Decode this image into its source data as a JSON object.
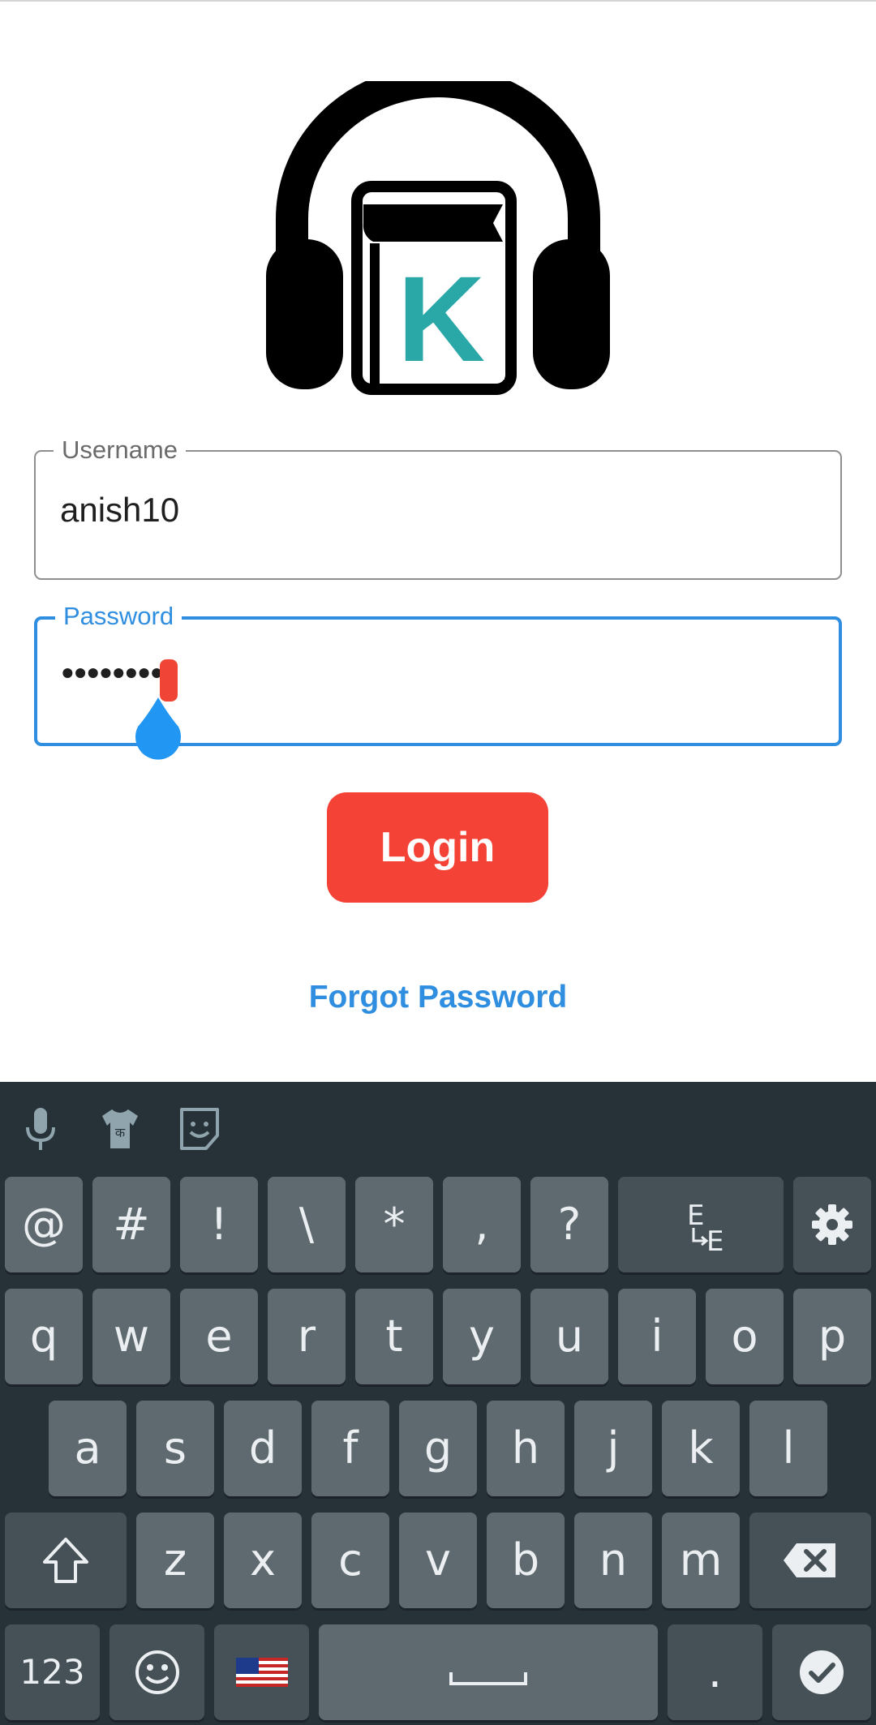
{
  "form": {
    "username_label": "Username",
    "username_value": "anish10",
    "password_label": "Password",
    "password_value": "••••••••",
    "login_label": "Login",
    "forgot_label": "Forgot Password"
  },
  "logo": {
    "letter": "K",
    "color_accent": "#2aa7a7"
  },
  "colors": {
    "primary": "#2f8ee0",
    "login": "#f44336",
    "keyboard_bg": "#263238",
    "key_bg": "#5f6a70"
  },
  "keyboard": {
    "toolbar": [
      "mic-icon",
      "shirt-icon",
      "sticker-icon"
    ],
    "row0": [
      "@",
      "#",
      "!",
      "\\",
      "*",
      ",",
      "?"
    ],
    "row1": [
      "q",
      "w",
      "e",
      "r",
      "t",
      "y",
      "u",
      "i",
      "o",
      "p"
    ],
    "row2": [
      "a",
      "s",
      "d",
      "f",
      "g",
      "h",
      "j",
      "k",
      "l"
    ],
    "row3": [
      "z",
      "x",
      "c",
      "v",
      "b",
      "n",
      "m"
    ],
    "numbers_label": "123",
    "period_label": ".",
    "shirt_glyph": "क"
  }
}
